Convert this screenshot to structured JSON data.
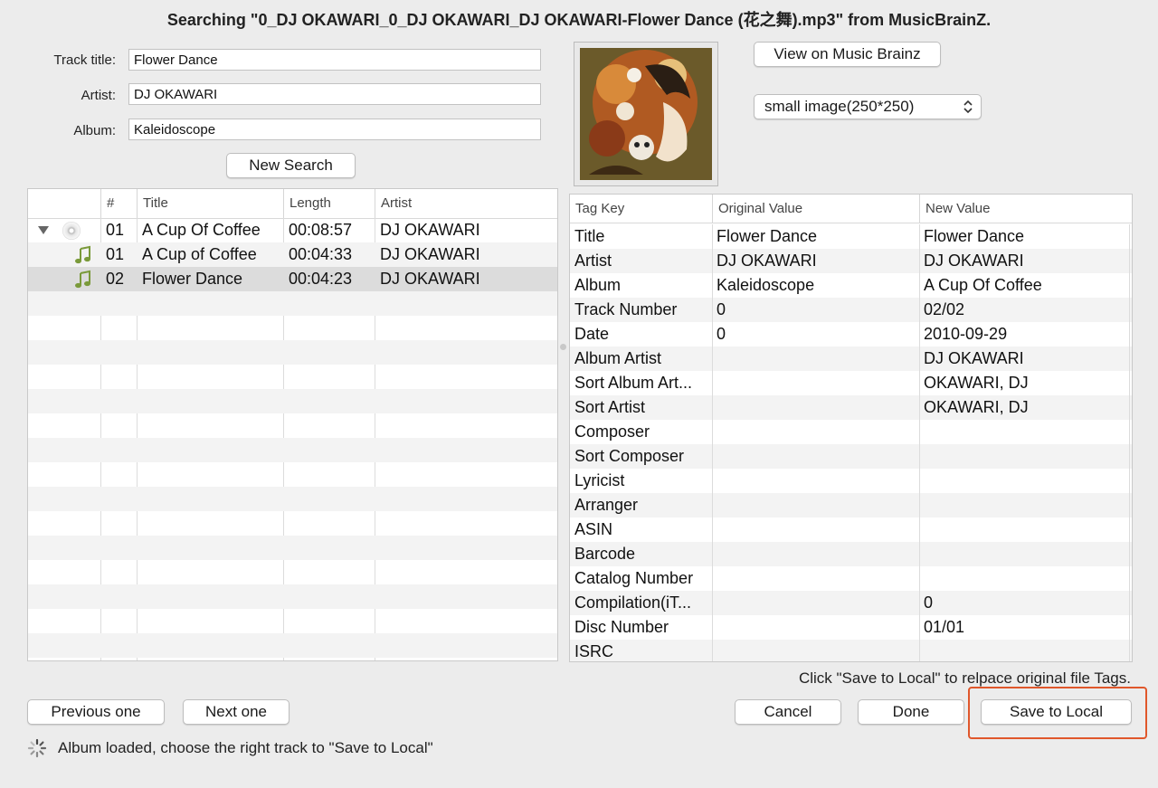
{
  "window": {
    "title": "Searching \"0_DJ OKAWARI_0_DJ OKAWARI_DJ OKAWARI-Flower Dance (花之舞).mp3\" from MusicBrainZ."
  },
  "search": {
    "track_title_label": "Track title:",
    "track_title_value": "Flower Dance",
    "artist_label": "Artist:",
    "artist_value": "DJ OKAWARI",
    "album_label": "Album:",
    "album_value": "Kaleidoscope",
    "new_search_label": "New Search"
  },
  "results": {
    "columns": [
      "",
      "#",
      "Title",
      "Length",
      "Artist"
    ],
    "rows": [
      {
        "icon": "cd-icon",
        "expanded": true,
        "num": "01",
        "title": "A Cup Of Coffee",
        "length": "00:08:57",
        "artist": "DJ OKAWARI"
      },
      {
        "icon": "music-note-icon",
        "num": "01",
        "title": "A Cup of Coffee",
        "length": "00:04:33",
        "artist": "DJ OKAWARI"
      },
      {
        "icon": "music-note-icon",
        "num": "02",
        "title": "Flower Dance",
        "length": "00:04:23",
        "artist": "DJ OKAWARI",
        "selected": true
      }
    ]
  },
  "cover": {
    "view_button_label": "View on Music Brainz",
    "size_select_value": "small image(250*250)"
  },
  "tags": {
    "columns": [
      "Tag Key",
      "Original Value",
      "New Value"
    ],
    "rows": [
      {
        "key": "Title",
        "original": "Flower Dance",
        "new": "Flower Dance"
      },
      {
        "key": "Artist",
        "original": "DJ OKAWARI",
        "new": "DJ OKAWARI"
      },
      {
        "key": "Album",
        "original": "Kaleidoscope",
        "new": "A Cup Of Coffee"
      },
      {
        "key": "Track Number",
        "original": "0",
        "new": "02/02"
      },
      {
        "key": "Date",
        "original": "0",
        "new": "2010-09-29"
      },
      {
        "key": "Album Artist",
        "original": "",
        "new": "DJ OKAWARI"
      },
      {
        "key": "Sort Album Art...",
        "original": "",
        "new": "OKAWARI, DJ"
      },
      {
        "key": "Sort Artist",
        "original": "",
        "new": "OKAWARI, DJ"
      },
      {
        "key": "Composer",
        "original": "",
        "new": ""
      },
      {
        "key": "Sort Composer",
        "original": "",
        "new": ""
      },
      {
        "key": "Lyricist",
        "original": "",
        "new": ""
      },
      {
        "key": "Arranger",
        "original": "",
        "new": ""
      },
      {
        "key": "ASIN",
        "original": "",
        "new": ""
      },
      {
        "key": "Barcode",
        "original": "",
        "new": ""
      },
      {
        "key": "Catalog Number",
        "original": "",
        "new": ""
      },
      {
        "key": "Compilation(iT...",
        "original": "",
        "new": "0"
      },
      {
        "key": "Disc Number",
        "original": "",
        "new": "01/01"
      },
      {
        "key": "ISRC",
        "original": "",
        "new": ""
      }
    ]
  },
  "footer": {
    "hint": "Click \"Save to Local\" to relpace  original file Tags.",
    "previous_label": "Previous one",
    "next_label": "Next one",
    "cancel_label": "Cancel",
    "done_label": "Done",
    "save_label": "Save to Local",
    "status": "Album loaded, choose the right track to \"Save to Local\""
  },
  "colors": {
    "highlight": "#e0572b",
    "selected_row": "#dcdcdc",
    "note_icon": "#7a9a3a"
  }
}
